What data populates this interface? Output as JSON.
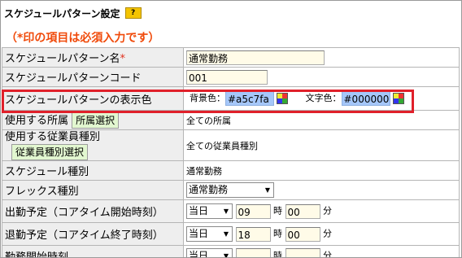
{
  "header": {
    "title": "スケジュールパターン設定",
    "help_label": "?"
  },
  "required_note": "（*印の項目は必須入力です）",
  "rows": {
    "pattern_name": {
      "label": "スケジュールパターン名",
      "req_mark": "*",
      "value": "通常勤務"
    },
    "pattern_code": {
      "label": "スケジュールパターンコード",
      "value": "001"
    },
    "display_color": {
      "label": "スケジュールパターンの表示色",
      "bg_label": "背景色：",
      "bg_value": "#a5c7fa",
      "text_label": "文字色：",
      "text_value": "#000000"
    },
    "department": {
      "label": "使用する所属",
      "button": "所属選択",
      "value": "全ての所属"
    },
    "employee_type": {
      "label": "使用する従業員種別",
      "button": "従業員種別選択",
      "value": "全ての従業員種別"
    },
    "schedule_type": {
      "label": "スケジュール種別",
      "value": "通常勤務"
    },
    "flex_type": {
      "label": "フレックス種別",
      "selected": "通常勤務"
    },
    "start_time": {
      "label": "出勤予定（コアタイム開始時刻）",
      "day": "当日",
      "hour": "09",
      "hour_unit": "時",
      "minute": "00",
      "minute_unit": "分"
    },
    "end_time": {
      "label": "退勤予定（コアタイム終了時刻）",
      "day": "当日",
      "hour": "18",
      "hour_unit": "時",
      "minute": "00",
      "minute_unit": "分"
    },
    "partial": {
      "label": "勤務開始時刻",
      "day": "当日",
      "hour_unit": "時",
      "minute_unit": "分"
    }
  },
  "colors": {
    "accent_red": "#e0202a",
    "required_orange": "#f04a0a",
    "button_green": "#e2f7d0"
  }
}
